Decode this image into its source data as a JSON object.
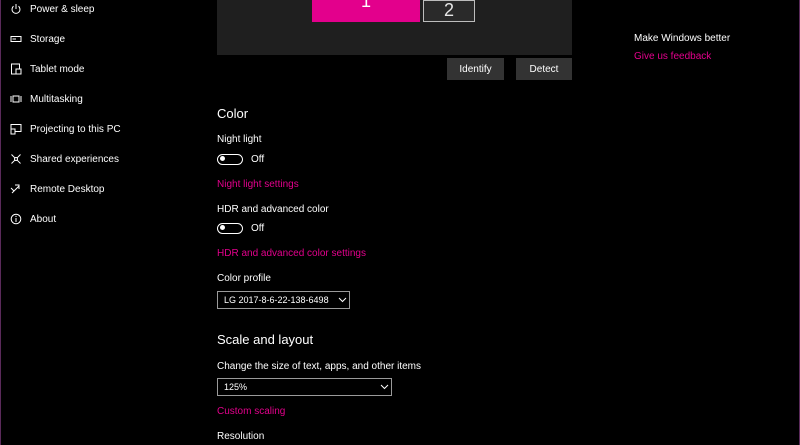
{
  "sidebar": {
    "items": [
      {
        "label": "Power & sleep",
        "icon": "power-icon"
      },
      {
        "label": "Storage",
        "icon": "storage-icon"
      },
      {
        "label": "Tablet mode",
        "icon": "tablet-icon"
      },
      {
        "label": "Multitasking",
        "icon": "multitasking-icon"
      },
      {
        "label": "Projecting to this PC",
        "icon": "projecting-icon"
      },
      {
        "label": "Shared experiences",
        "icon": "shared-icon"
      },
      {
        "label": "Remote Desktop",
        "icon": "remote-desktop-icon"
      },
      {
        "label": "About",
        "icon": "info-icon"
      }
    ]
  },
  "display": {
    "monitor1": "1",
    "monitor2": "2",
    "identify_label": "Identify",
    "detect_label": "Detect"
  },
  "color": {
    "title": "Color",
    "night_light_label": "Night light",
    "night_light_state": "Off",
    "night_light_link": "Night light settings",
    "hdr_label": "HDR and advanced color",
    "hdr_state": "Off",
    "hdr_link": "HDR and advanced color settings",
    "profile_label": "Color profile",
    "profile_value": "LG 2017-8-6-22-138-6498"
  },
  "scale": {
    "title": "Scale and layout",
    "size_label": "Change the size of text, apps, and other items",
    "size_value": "125%",
    "custom_link": "Custom scaling",
    "resolution_label": "Resolution"
  },
  "right": {
    "heading": "Make Windows better",
    "feedback_link": "Give us feedback"
  },
  "colors": {
    "accent": "#e3008c",
    "background": "#000000",
    "button": "#333333"
  }
}
